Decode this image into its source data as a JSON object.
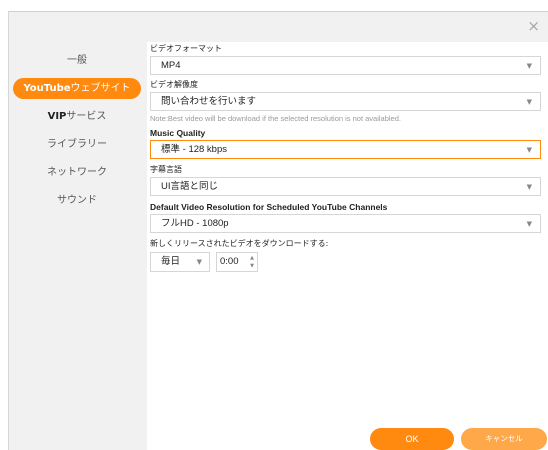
{
  "dialog": {
    "close_icon": "×"
  },
  "sidebar": {
    "items": [
      {
        "label": "一般"
      },
      {
        "label_bold": "YouTube",
        "label": "ウェブサイト"
      },
      {
        "label_bold": "VIP",
        "label": "サービス"
      },
      {
        "label": "ライブラリー"
      },
      {
        "label": "ネットワーク"
      },
      {
        "label": "サウンド"
      }
    ]
  },
  "settings": {
    "video_format": {
      "label": "ビデオフォーマット",
      "value": "MP4"
    },
    "video_resolution": {
      "label": "ビデオ解像度",
      "value": "問い合わせを行います",
      "note": "Note:Best video will be download if the selected resolution is not availabled."
    },
    "music_quality": {
      "label": "Music Quality",
      "value": "標準 - 128 kbps"
    },
    "subtitle_language": {
      "label": "字幕言語",
      "value": "UI言語と同じ"
    },
    "scheduled_resolution": {
      "label": "Default Video Resolution for Scheduled YouTube Channels",
      "value": "フルHD - 1080p"
    },
    "download_new": {
      "label": "新しくリリースされたビデオをダウンロードする:",
      "frequency": "毎日",
      "time": "0:00"
    }
  },
  "buttons": {
    "ok": "OK",
    "cancel": "キャンセル"
  },
  "colors": {
    "accent": "#ff8a0f",
    "cancel": "#ffa84a"
  },
  "icons": {
    "caret": "chevron-down-icon",
    "close": "close-icon"
  }
}
